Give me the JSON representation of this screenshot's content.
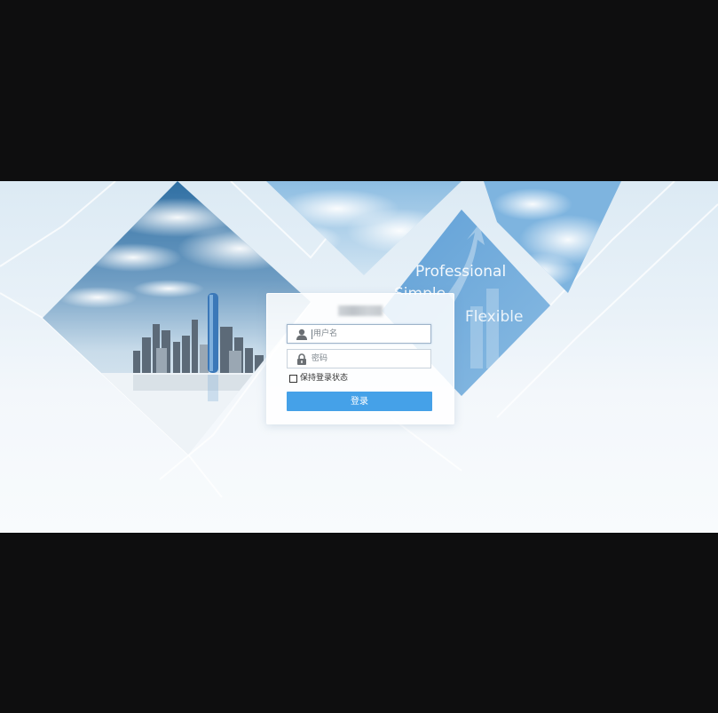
{
  "taglines": [
    "Professional",
    "Simple",
    "Flexible"
  ],
  "form": {
    "username_placeholder": "用户名",
    "password_placeholder": "密码",
    "remember_label": "保持登录状态",
    "login_label": "登录"
  },
  "colors": {
    "accent": "#45a1e8",
    "letterbox": "#0e0e0f"
  },
  "icons": {
    "username": "user-icon",
    "password": "lock-icon"
  }
}
